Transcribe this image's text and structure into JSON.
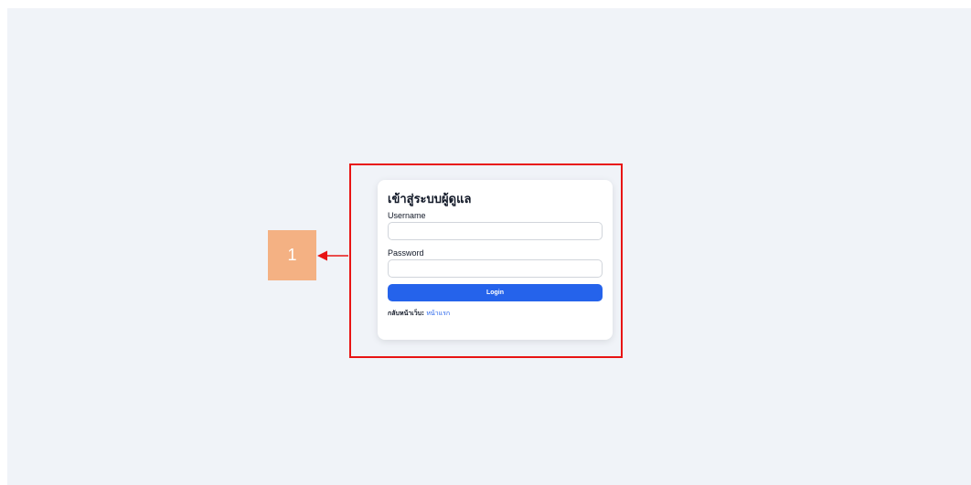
{
  "login": {
    "title": "เข้าสู่ระบบผู้ดูแล",
    "username_label": "Username",
    "username_value": "",
    "password_label": "Password",
    "password_value": "",
    "login_button": "Login",
    "back_prefix": "กลับหน้าเว็บ:",
    "back_link": "หน้าแรก"
  },
  "annotation": {
    "callout_number": "1",
    "frame_color": "#e81414",
    "callout_color": "#f4b183",
    "arrow_color": "#e81414"
  },
  "theme": {
    "background": "#f0f3f8",
    "accent": "#2563eb"
  }
}
